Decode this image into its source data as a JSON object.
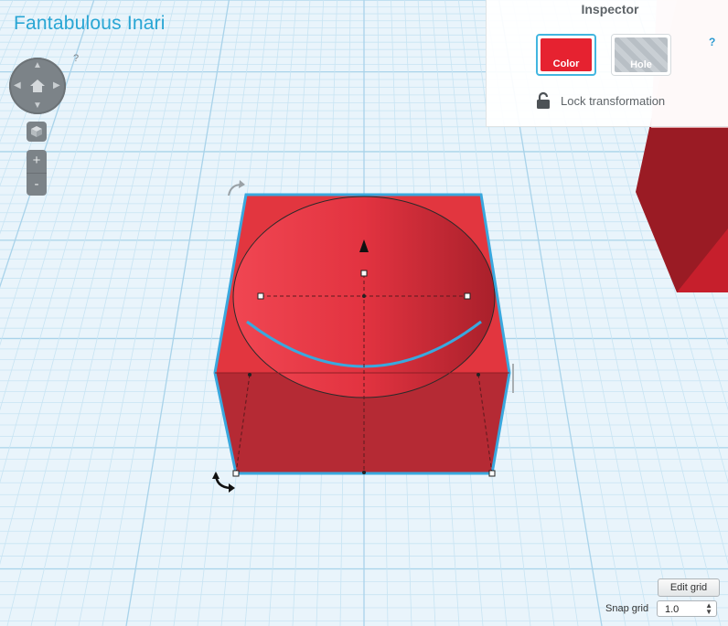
{
  "app": {
    "title": "Fantabulous Inari"
  },
  "view_controls": {
    "help": "?",
    "zoom_in": "+",
    "zoom_out": "-"
  },
  "inspector": {
    "title": "Inspector",
    "help": "?",
    "color_label": "Color",
    "hole_label": "Hole",
    "lock_label": "Lock transformation",
    "selected_color": "#e62230"
  },
  "grid": {
    "edit_label": "Edit grid",
    "snap_label": "Snap grid",
    "snap_value": "1.0"
  },
  "icons": {
    "home": "home-icon",
    "view_cube": "view-cube-icon",
    "rotate": "rotate-arrow-icon",
    "lock": "lock-icon"
  }
}
